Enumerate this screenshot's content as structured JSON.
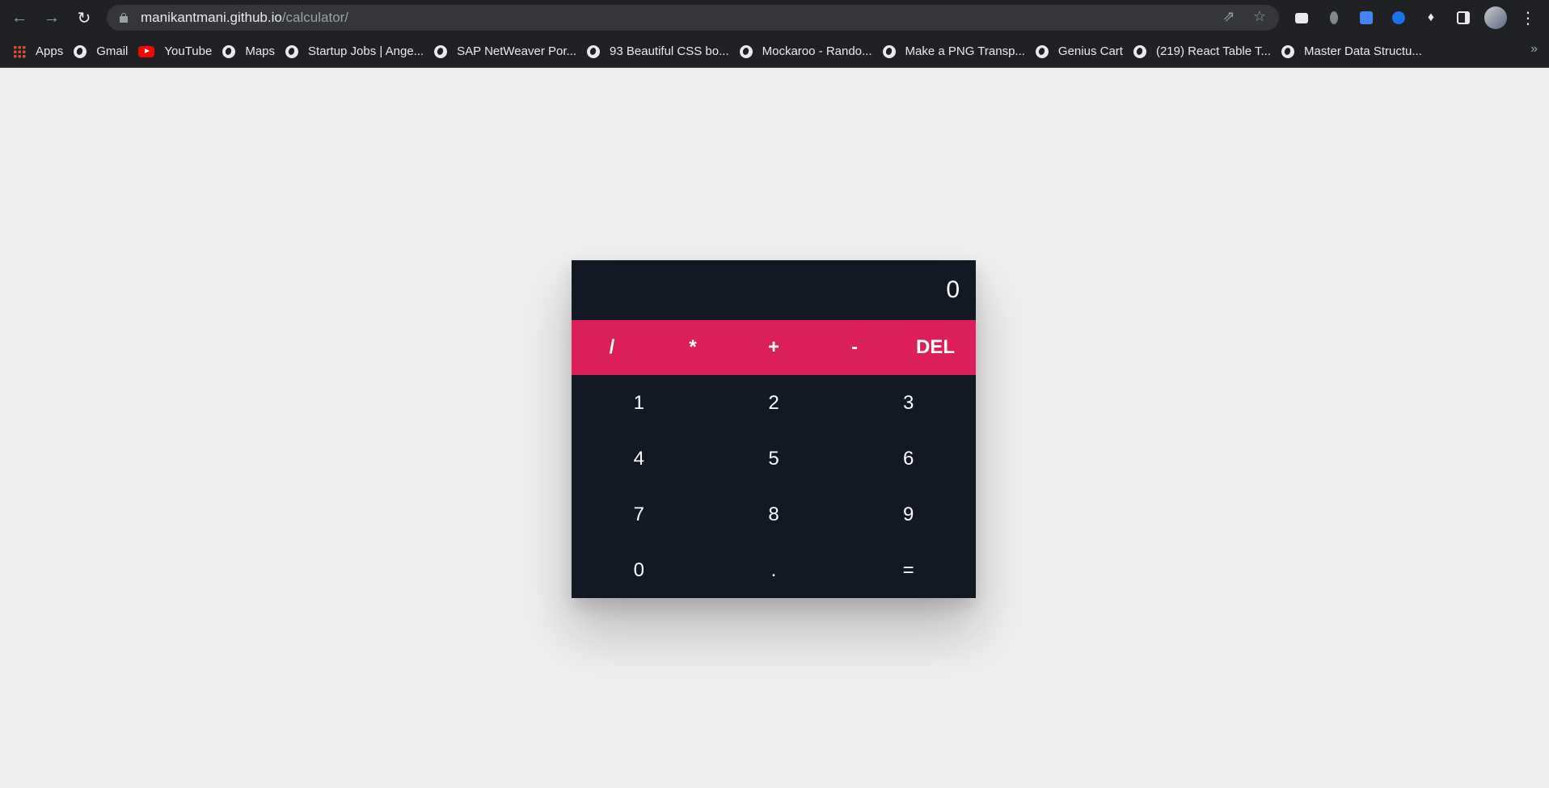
{
  "browser": {
    "url_host": "manikantmani.github.io",
    "url_path": "/calculator/",
    "icons": [
      "back-arrow-icon",
      "forward-arrow-icon",
      "reload-icon",
      "lock-icon",
      "share-icon",
      "star-icon",
      "extensions-puzzle-icon",
      "side-panel-icon",
      "menu-kebab-icon"
    ]
  },
  "bookmarks": [
    {
      "label": "Apps",
      "icon": "apps"
    },
    {
      "label": "Gmail",
      "icon": "globe"
    },
    {
      "label": "YouTube",
      "icon": "youtube"
    },
    {
      "label": "Maps",
      "icon": "globe"
    },
    {
      "label": "Startup Jobs | Ange...",
      "icon": "globe"
    },
    {
      "label": "SAP NetWeaver Por...",
      "icon": "globe"
    },
    {
      "label": "93 Beautiful CSS bo...",
      "icon": "globe"
    },
    {
      "label": "Mockaroo - Rando...",
      "icon": "globe"
    },
    {
      "label": "Make a PNG Transp...",
      "icon": "globe"
    },
    {
      "label": "Genius Cart",
      "icon": "globe"
    },
    {
      "label": "(219) React Table T...",
      "icon": "globe"
    },
    {
      "label": "Master Data Structu...",
      "icon": "globe"
    }
  ],
  "calculator": {
    "display": "0",
    "operators": [
      "/",
      "*",
      "+",
      "-",
      "DEL"
    ],
    "digits": [
      "1",
      "2",
      "3",
      "4",
      "5",
      "6",
      "7",
      "8",
      "9",
      "0",
      ".",
      "="
    ],
    "colors": {
      "body": "#121824",
      "operators_bar": "#dc1f5a",
      "text": "#ffffff",
      "page_bg": "#eeeeee"
    }
  }
}
